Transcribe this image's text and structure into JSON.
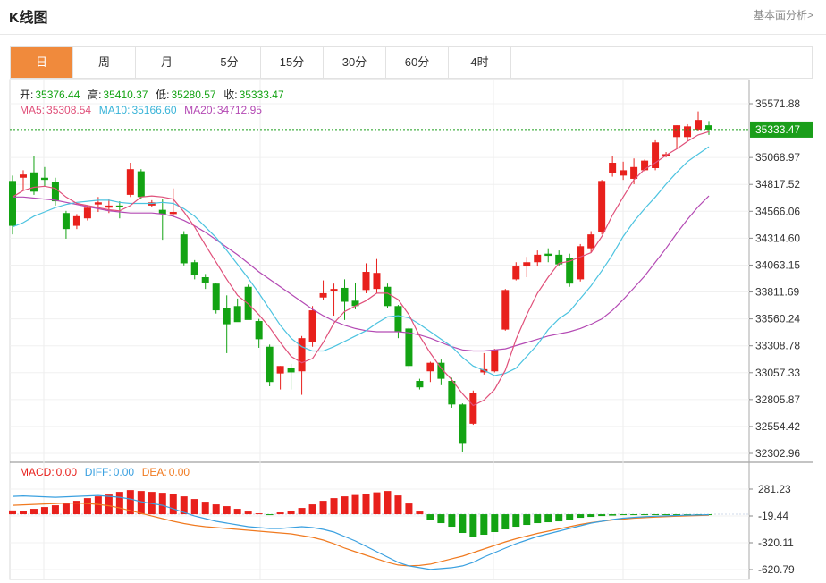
{
  "header": {
    "title": "K线图",
    "analysis_link": "基本面分析>"
  },
  "tabs": [
    {
      "label": "日",
      "active": true
    },
    {
      "label": "周",
      "active": false
    },
    {
      "label": "月",
      "active": false
    },
    {
      "label": "5分",
      "active": false
    },
    {
      "label": "15分",
      "active": false
    },
    {
      "label": "30分",
      "active": false
    },
    {
      "label": "60分",
      "active": false
    },
    {
      "label": "4时",
      "active": false
    }
  ],
  "ohlc_info": {
    "open_label": "开:",
    "open": "35376.44",
    "high_label": "高:",
    "high": "35410.37",
    "low_label": "低:",
    "low": "35280.57",
    "close_label": "收:",
    "close": "35333.47"
  },
  "ma_info": {
    "ma5_label": "MA5:",
    "ma5": "35308.54",
    "ma10_label": "MA10:",
    "ma10": "35166.60",
    "ma20_label": "MA20:",
    "ma20": "34712.95"
  },
  "macd_info": {
    "macd_label": "MACD:",
    "macd": "0.00",
    "diff_label": "DIFF:",
    "diff": "0.00",
    "dea_label": "DEA:",
    "dea": "0.00"
  },
  "colors": {
    "up": "#e8201c",
    "down": "#13a313",
    "ma5": "#e0507a",
    "ma10": "#4cc3e0",
    "ma20": "#b44ab4",
    "diff": "#3aa0e0",
    "dea": "#f07a20",
    "last_price": "#1a9e1a"
  },
  "chart_data": [
    {
      "type": "candlestick",
      "y_ticks": [
        "35571.88",
        "35068.97",
        "34817.52",
        "34566.06",
        "34314.60",
        "34063.15",
        "33811.69",
        "33560.24",
        "33308.78",
        "33057.33",
        "32805.87",
        "32554.42",
        "32302.96"
      ],
      "ylim": [
        32302.96,
        35571.88
      ],
      "last_price_label": "35333.47",
      "candles": [
        [
          34850,
          34900,
          34350,
          34430
        ],
        [
          34880,
          34950,
          34760,
          34910
        ],
        [
          34930,
          35080,
          34720,
          34750
        ],
        [
          34880,
          34980,
          34800,
          34860
        ],
        [
          34840,
          34880,
          34620,
          34660
        ],
        [
          34550,
          34570,
          34310,
          34400
        ],
        [
          34430,
          34540,
          34400,
          34520
        ],
        [
          34500,
          34620,
          34480,
          34600
        ],
        [
          34630,
          34700,
          34560,
          34650
        ],
        [
          34600,
          34680,
          34550,
          34620
        ],
        [
          34620,
          34660,
          34500,
          34610
        ],
        [
          34720,
          35020,
          34700,
          34960
        ],
        [
          34940,
          34960,
          34680,
          34700
        ],
        [
          34620,
          34670,
          34610,
          34650
        ],
        [
          34580,
          34680,
          34300,
          34540
        ],
        [
          34540,
          34780,
          34510,
          34560
        ],
        [
          34350,
          34380,
          34060,
          34080
        ],
        [
          34090,
          34110,
          33930,
          33970
        ],
        [
          33950,
          33980,
          33840,
          33900
        ],
        [
          33890,
          33900,
          33610,
          33640
        ],
        [
          33660,
          33780,
          33240,
          33510
        ],
        [
          33680,
          33750,
          33570,
          33530
        ],
        [
          33860,
          33880,
          33560,
          33550
        ],
        [
          33540,
          33560,
          33290,
          33370
        ],
        [
          33300,
          33320,
          32930,
          32970
        ],
        [
          33050,
          33120,
          32900,
          33120
        ],
        [
          33100,
          33140,
          32900,
          33060
        ],
        [
          33070,
          33400,
          32850,
          33380
        ],
        [
          33340,
          33680,
          33300,
          33640
        ],
        [
          33760,
          33920,
          33740,
          33800
        ],
        [
          33820,
          33890,
          33590,
          33840
        ],
        [
          33850,
          33930,
          33550,
          33720
        ],
        [
          33730,
          33900,
          33650,
          33680
        ],
        [
          33830,
          34080,
          33800,
          34000
        ],
        [
          33840,
          34120,
          33800,
          33990
        ],
        [
          33860,
          33890,
          33660,
          33680
        ],
        [
          33680,
          33690,
          33380,
          33440
        ],
        [
          33470,
          33480,
          33090,
          33120
        ],
        [
          32980,
          33000,
          32900,
          32920
        ],
        [
          33070,
          33160,
          32970,
          33150
        ],
        [
          33150,
          33180,
          32940,
          33000
        ],
        [
          32980,
          33010,
          32730,
          32760
        ],
        [
          32760,
          32770,
          32320,
          32400
        ],
        [
          32580,
          32890,
          32570,
          32870
        ],
        [
          33060,
          33240,
          33040,
          33090
        ],
        [
          33070,
          33280,
          33060,
          33270
        ],
        [
          33460,
          33840,
          33450,
          33830
        ],
        [
          33930,
          34090,
          33920,
          34050
        ],
        [
          34050,
          34140,
          33950,
          34090
        ],
        [
          34090,
          34200,
          34050,
          34160
        ],
        [
          34170,
          34220,
          34090,
          34150
        ],
        [
          34160,
          34200,
          34050,
          34070
        ],
        [
          34130,
          34170,
          33860,
          33890
        ],
        [
          33930,
          34260,
          33910,
          34240
        ],
        [
          34220,
          34380,
          34180,
          34350
        ],
        [
          34370,
          34860,
          34350,
          34850
        ],
        [
          34920,
          35080,
          34890,
          35020
        ],
        [
          34900,
          35030,
          34860,
          34950
        ],
        [
          34870,
          35060,
          34820,
          34980
        ],
        [
          34950,
          35050,
          34940,
          35040
        ],
        [
          34970,
          35230,
          34950,
          35210
        ],
        [
          35080,
          35120,
          35070,
          35100
        ],
        [
          35260,
          35370,
          35150,
          35370
        ],
        [
          35260,
          35380,
          35220,
          35360
        ],
        [
          35330,
          35500,
          35320,
          35420
        ],
        [
          35370,
          35410,
          35280,
          35330
        ]
      ],
      "ma5": [
        34700,
        34760,
        34790,
        34800,
        34780,
        34700,
        34640,
        34620,
        34600,
        34580,
        34570,
        34620,
        34700,
        34710,
        34700,
        34680,
        34560,
        34420,
        34250,
        34090,
        33930,
        33780,
        33700,
        33600,
        33480,
        33340,
        33210,
        33150,
        33190,
        33340,
        33520,
        33630,
        33680,
        33730,
        33800,
        33800,
        33740,
        33600,
        33400,
        33240,
        33100,
        32990,
        32860,
        32750,
        32800,
        32900,
        33080,
        33370,
        33600,
        33800,
        33950,
        34080,
        34100,
        34140,
        34180,
        34330,
        34530,
        34700,
        34860,
        34960,
        35020,
        35090,
        35150,
        35220,
        35280,
        35310
      ],
      "ma10": [
        34420,
        34460,
        34520,
        34560,
        34600,
        34630,
        34650,
        34660,
        34670,
        34670,
        34650,
        34640,
        34640,
        34640,
        34650,
        34640,
        34590,
        34520,
        34420,
        34320,
        34200,
        34070,
        33940,
        33800,
        33650,
        33500,
        33380,
        33300,
        33260,
        33260,
        33300,
        33350,
        33400,
        33450,
        33520,
        33580,
        33590,
        33570,
        33510,
        33440,
        33370,
        33300,
        33200,
        33120,
        33080,
        33030,
        33050,
        33100,
        33210,
        33320,
        33460,
        33560,
        33630,
        33750,
        33870,
        34010,
        34160,
        34330,
        34470,
        34590,
        34700,
        34820,
        34930,
        35030,
        35100,
        35170
      ],
      "ma20": [
        34700,
        34700,
        34690,
        34680,
        34670,
        34650,
        34630,
        34610,
        34590,
        34570,
        34560,
        34550,
        34550,
        34550,
        34540,
        34520,
        34480,
        34430,
        34370,
        34300,
        34230,
        34160,
        34080,
        34000,
        33930,
        33860,
        33790,
        33720,
        33650,
        33590,
        33540,
        33500,
        33470,
        33450,
        33440,
        33440,
        33440,
        33430,
        33410,
        33380,
        33340,
        33300,
        33270,
        33260,
        33260,
        33270,
        33280,
        33310,
        33340,
        33370,
        33400,
        33420,
        33440,
        33470,
        33510,
        33560,
        33640,
        33740,
        33850,
        33960,
        34090,
        34220,
        34360,
        34490,
        34610,
        34710
      ]
    },
    {
      "type": "macd",
      "y_ticks": [
        "281.23",
        "-19.44",
        "-320.11",
        "-620.79"
      ],
      "ylim": [
        -620.79,
        281.23
      ],
      "histogram": [
        42,
        40,
        60,
        80,
        100,
        120,
        150,
        180,
        200,
        220,
        250,
        270,
        260,
        250,
        240,
        230,
        200,
        170,
        140,
        110,
        90,
        60,
        30,
        10,
        -5,
        20,
        40,
        70,
        110,
        150,
        180,
        200,
        215,
        230,
        245,
        260,
        210,
        120,
        30,
        -60,
        -100,
        -140,
        -210,
        -250,
        -230,
        -200,
        -170,
        -140,
        -120,
        -100,
        -90,
        -80,
        -60,
        -40,
        -30,
        -20,
        -15,
        -10,
        -8,
        -6,
        -5,
        -4,
        -3,
        -2,
        -2,
        -1
      ],
      "diff": [
        200,
        205,
        200,
        195,
        190,
        195,
        200,
        205,
        210,
        200,
        190,
        170,
        140,
        120,
        100,
        60,
        20,
        -20,
        -50,
        -80,
        -100,
        -120,
        -140,
        -150,
        -160,
        -160,
        -150,
        -140,
        -150,
        -170,
        -200,
        -250,
        -300,
        -360,
        -420,
        -480,
        -540,
        -580,
        -600,
        -620,
        -610,
        -600,
        -580,
        -540,
        -480,
        -430,
        -380,
        -330,
        -290,
        -250,
        -220,
        -190,
        -160,
        -130,
        -100,
        -80,
        -60,
        -45,
        -35,
        -28,
        -22,
        -18,
        -14,
        -10,
        -8,
        -5
      ],
      "dea": [
        100,
        105,
        110,
        115,
        120,
        125,
        125,
        120,
        110,
        95,
        70,
        40,
        10,
        -20,
        -50,
        -80,
        -105,
        -125,
        -140,
        -150,
        -160,
        -170,
        -180,
        -190,
        -200,
        -210,
        -220,
        -240,
        -260,
        -290,
        -330,
        -380,
        -420,
        -460,
        -500,
        -540,
        -570,
        -580,
        -575,
        -560,
        -530,
        -500,
        -470,
        -430,
        -390,
        -350,
        -310,
        -275,
        -245,
        -215,
        -190,
        -165,
        -140,
        -115,
        -95,
        -80,
        -65,
        -55,
        -45,
        -38,
        -32,
        -27,
        -22,
        -18,
        -14,
        -10
      ]
    }
  ]
}
